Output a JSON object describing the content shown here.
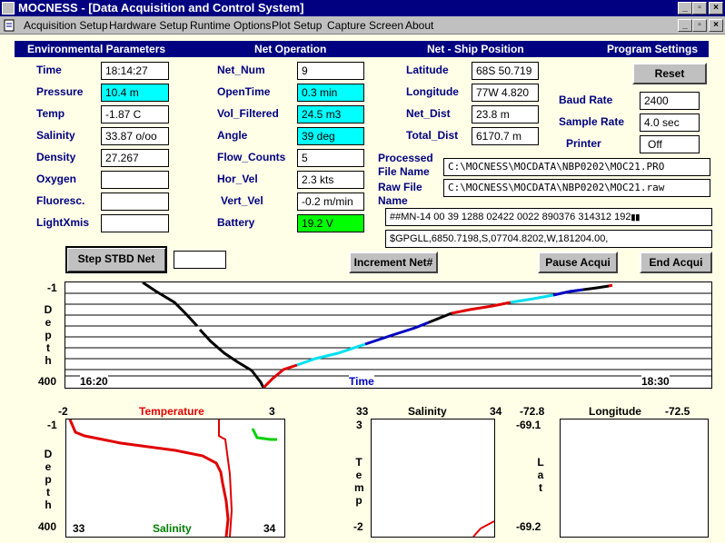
{
  "window": {
    "title": "MOCNESS - [Data Acquisition and Control System]"
  },
  "menu": [
    "Acquisition Setup",
    "Hardware Setup",
    "Runtime Options",
    "Plot Setup",
    "Capture Screen",
    "About"
  ],
  "sections": [
    "Environmental Parameters",
    "Net Operation",
    "Net - Ship Position",
    "Program Settings"
  ],
  "env": [
    {
      "label": "Time",
      "value": "18:14:27"
    },
    {
      "label": "Pressure",
      "value": "10.4 m"
    },
    {
      "label": "Temp",
      "value": "-1.87 C"
    },
    {
      "label": "Salinity",
      "value": "33.87 o/oo"
    },
    {
      "label": "Density",
      "value": "27.267"
    },
    {
      "label": "Oxygen",
      "value": ""
    },
    {
      "label": "Fluoresc.",
      "value": ""
    },
    {
      "label": "LightXmis",
      "value": ""
    }
  ],
  "net": [
    {
      "label": "Net_Num",
      "value": "9"
    },
    {
      "label": "OpenTime",
      "value": "0.3 min"
    },
    {
      "label": "Vol_Filtered",
      "value": "24.5 m3"
    },
    {
      "label": "Angle",
      "value": "39 deg"
    },
    {
      "label": "Flow_Counts",
      "value": "5"
    },
    {
      "label": "Hor_Vel",
      "value": "2.3 kts"
    },
    {
      "label": "Vert_Vel",
      "value": "-0.2 m/min"
    },
    {
      "label": "Battery",
      "value": "19.2 V"
    }
  ],
  "pos": [
    {
      "label": "Latitude",
      "value": "68S 50.719"
    },
    {
      "label": "Longitude",
      "value": "77W 4.820"
    },
    {
      "label": "Net_Dist",
      "value": "23.8 m"
    },
    {
      "label": "Total_Dist",
      "value": "6170.7 m"
    }
  ],
  "settings": {
    "reset": "Reset",
    "baud_label": "Baud Rate",
    "baud": "2400",
    "sample_label": "Sample Rate",
    "sample": "4.0 sec",
    "printer_label": "Printer",
    "printer": "Off"
  },
  "files": {
    "processed_label1": "Processed",
    "processed_label2": "File Name",
    "processed": "C:\\MOCNESS\\MOCDATA\\NBP0202\\MOC21.PRO",
    "raw_label1": "Raw File",
    "raw_label2": "Name",
    "raw": "C:\\MOCNESS\\MOCDATA\\NBP0202\\MOC21.raw",
    "raw_string": "##MN-14 00 39 1288 02422 0022 890376 314312 192",
    "gps_string": "$GPGLL,6850.7198,S,07704.8202,W,181204.00,"
  },
  "buttons": {
    "step": "Step STBD Net",
    "step_value": "",
    "increment": "Increment Net#",
    "pause": "Pause Acqui",
    "end": "End Acqui"
  },
  "depth_time_chart": {
    "y_top": "-1",
    "y_bottom": "400",
    "y_label": [
      "D",
      "e",
      "p",
      "t",
      "h"
    ],
    "x_left": "16:20",
    "x_right": "18:30",
    "x_label": "Time"
  },
  "temp_chart": {
    "x_left": "-2",
    "x_right": "3",
    "title": "Temperature",
    "bottom_left": "33",
    "bottom_right": "34",
    "bottom_title": "Salinity",
    "y_top": "-1",
    "y_bottom": "400",
    "y_label": [
      "D",
      "e",
      "p",
      "t",
      "h"
    ]
  },
  "ts_chart": {
    "x_left": "33",
    "x_right": "34",
    "title": "Salinity",
    "y_top": "3",
    "y_bottom": "-2",
    "y_label": [
      "T",
      "e",
      "m",
      "p"
    ]
  },
  "lon_chart": {
    "x_left": "-72.8",
    "x_right": "-72.5",
    "title": "Longitude",
    "y_top": "-69.1",
    "y_bottom": "-69.2",
    "y_label": [
      "L",
      "a",
      "t"
    ]
  },
  "colors": {
    "titlebar": "#000080",
    "background": "#ffffe8",
    "cyan": "#00ffff",
    "green": "#00ff00",
    "red": "#e00000",
    "blue": "#0000c0"
  }
}
